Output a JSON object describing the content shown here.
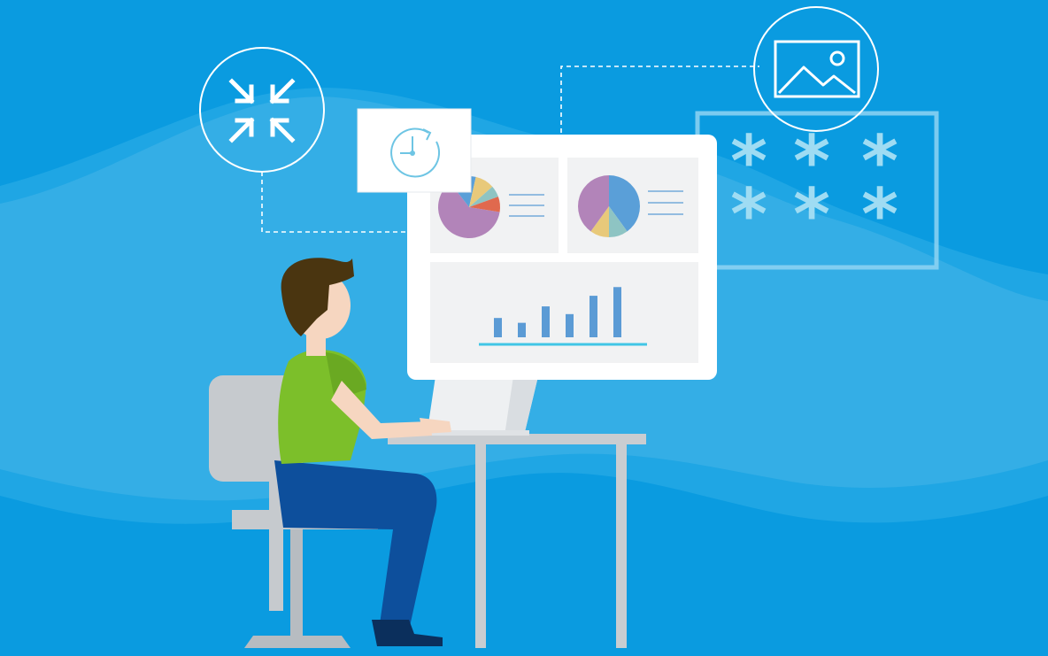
{
  "scene": {
    "background": "#0a9be0",
    "wave": "#4fb8ea",
    "line_color": "#ffffff",
    "screen_fill": "#ffffff",
    "panel_fill": "#f2f3f4",
    "bar_color": "#5b9bd5",
    "baseline_color": "#41c6e6"
  },
  "pie_charts": [
    {
      "slices": [
        {
          "fraction": 0.62,
          "color": "#b284b9"
        },
        {
          "fraction": 0.14,
          "color": "#5a9fd8"
        },
        {
          "fraction": 0.1,
          "color": "#e8c97a"
        },
        {
          "fraction": 0.06,
          "color": "#8ec4c3"
        },
        {
          "fraction": 0.08,
          "color": "#e0694e"
        }
      ]
    },
    {
      "slices": [
        {
          "fraction": 0.4,
          "color": "#5a9fd8"
        },
        {
          "fraction": 0.1,
          "color": "#8ec4c3"
        },
        {
          "fraction": 0.1,
          "color": "#e8c97a"
        },
        {
          "fraction": 0.4,
          "color": "#b284b9"
        }
      ]
    }
  ],
  "bar_chart": {
    "values": [
      2,
      1.5,
      3.2,
      2.4,
      4.3,
      5.2
    ],
    "max": 5.5
  },
  "asterisks": [
    "*",
    "*",
    "*",
    "*",
    "*",
    "*"
  ],
  "icons": {
    "compress": "compress-arrows-icon",
    "image": "image-icon",
    "clock": "clock-refresh-icon",
    "password": "password-asterisk-icon"
  }
}
